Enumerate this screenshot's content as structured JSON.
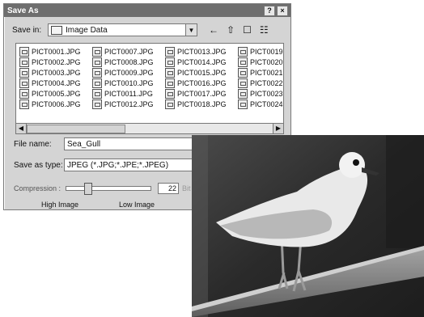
{
  "dialog": {
    "title": "Save As",
    "help_btn": "?",
    "close_btn": "×",
    "save_in_label": "Save in:",
    "save_in_value": "Image Data",
    "tool_icons": [
      "back-icon",
      "up-folder-icon",
      "new-folder-icon",
      "view-menu-icon"
    ],
    "files": [
      [
        "PICT0001.JPG",
        "PICT0002.JPG",
        "PICT0003.JPG",
        "PICT0004.JPG",
        "PICT0005.JPG",
        "PICT0006.JPG"
      ],
      [
        "PICT0007.JPG",
        "PICT0008.JPG",
        "PICT0009.JPG",
        "PICT0010.JPG",
        "PICT0011.JPG",
        "PICT0012.JPG"
      ],
      [
        "PICT0013.JPG",
        "PICT0014.JPG",
        "PICT0015.JPG",
        "PICT0016.JPG",
        "PICT0017.JPG",
        "PICT0018.JPG"
      ],
      [
        "PICT0019.",
        "PICT0020.",
        "PICT0021.",
        "PICT0022.",
        "PICT0023.",
        "PICT0024."
      ]
    ],
    "file_name_label": "File name:",
    "file_name_value": "Sea_Gull",
    "save_type_label": "Save as type:",
    "save_type_value": "JPEG (*.JPG;*.JPE;*.JPEG)",
    "compression_label": "Compression :",
    "compression_value": "22",
    "compression_units": "Bit leng",
    "quality_high": "High Image",
    "quality_low": "Low Image"
  },
  "colors": {
    "titlebar": "#6e6e6e",
    "dialog_bg": "#d4d4d4"
  }
}
